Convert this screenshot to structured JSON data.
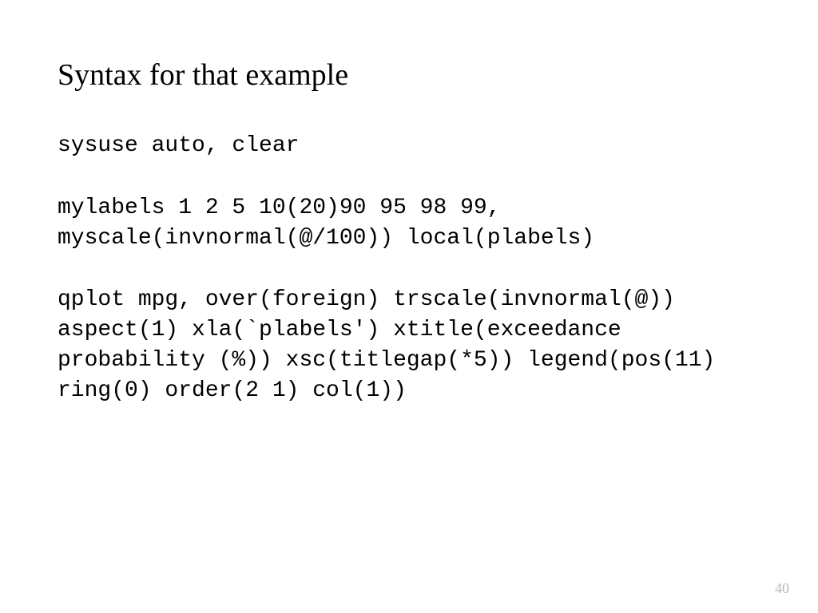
{
  "title": "Syntax for that example",
  "code": {
    "block1": "sysuse auto, clear",
    "block2": "mylabels 1 2 5 10(20)90 95 98 99, myscale(invnormal(@/100)) local(plabels)",
    "block3": "qplot mpg, over(foreign) trscale(invnormal(@)) aspect(1) xla(`plabels') xtitle(exceedance probability (%)) xsc(titlegap(*5)) legend(pos(11) ring(0) order(2 1) col(1))"
  },
  "page_number": "40"
}
